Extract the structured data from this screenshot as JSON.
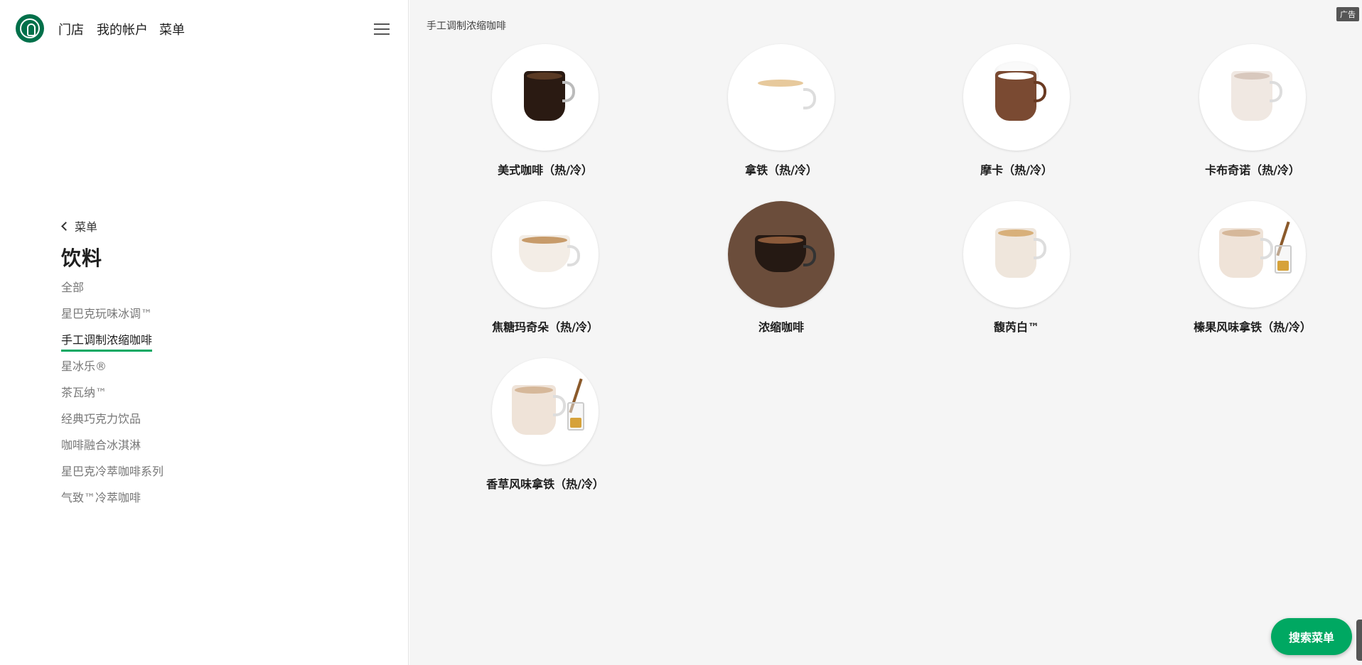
{
  "nav": {
    "stores": "门店",
    "account": "我的帐户",
    "menu": "菜单"
  },
  "sidemenu": {
    "back": "菜单",
    "title": "饮料",
    "categories": [
      "全部",
      "星巴克玩味冰调™",
      "手工调制浓缩咖啡",
      "星冰乐®",
      "茶瓦纳™",
      "经典巧克力饮品",
      "咖啡融合冰淇淋",
      "星巴克冷萃咖啡系列",
      "气致™冷萃咖啡"
    ],
    "active_index": 2
  },
  "content": {
    "section_title": "手工调制浓缩咖啡",
    "ad_label": "广告",
    "items": [
      {
        "name": "美式咖啡（热/冷）",
        "image": "americano-cup-icon"
      },
      {
        "name": "拿铁（热/冷）",
        "image": "latte-cup-icon"
      },
      {
        "name": "摩卡（热/冷）",
        "image": "mocha-cup-icon"
      },
      {
        "name": "卡布奇诺（热/冷）",
        "image": "cappuccino-cup-icon"
      },
      {
        "name": "焦糖玛奇朵（热/冷）",
        "image": "caramel-macchiato-cup-icon"
      },
      {
        "name": "浓缩咖啡",
        "image": "espresso-cup-icon"
      },
      {
        "name": "馥芮白™",
        "image": "flat-white-cup-icon"
      },
      {
        "name": "榛果风味拿铁（热/冷）",
        "image": "hazelnut-latte-cup-icon"
      },
      {
        "name": "香草风味拿铁（热/冷）",
        "image": "vanilla-latte-cup-icon"
      }
    ]
  },
  "search_button": "搜索菜单",
  "colors": {
    "brand_green": "#00704a",
    "accent_green": "#00a862",
    "content_bg": "#f5f5f5"
  }
}
